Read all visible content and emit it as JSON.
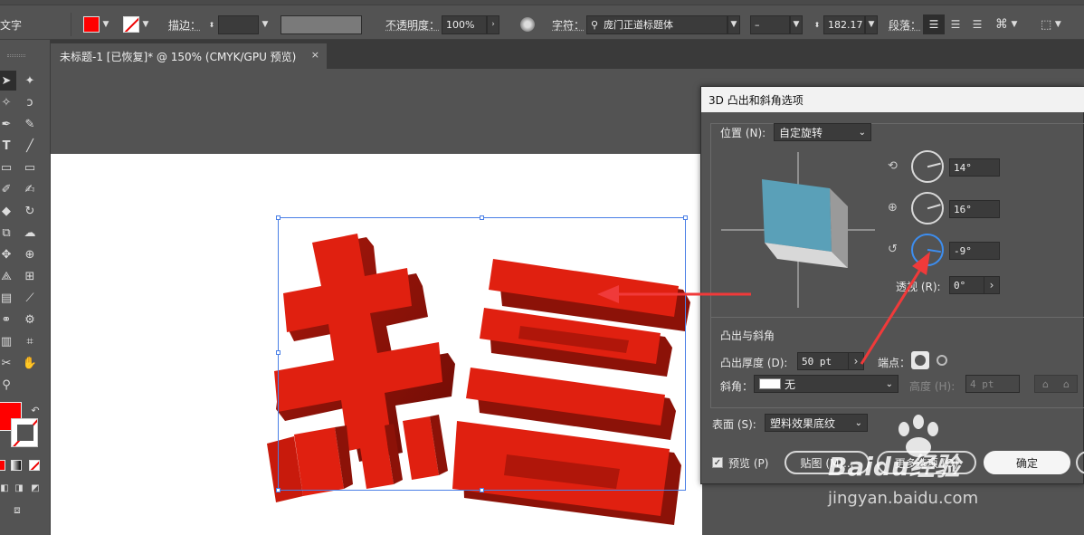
{
  "control_bar": {
    "left_label": "文字",
    "stroke_label": "描边：",
    "opacity_label": "不透明度：",
    "opacity_value": "100%",
    "char_label": "字符：",
    "font_name": "庞门正道标题体",
    "font_style": "–",
    "font_size": "182.17",
    "para_label": "段落：",
    "fill_color": "#ff0000"
  },
  "document_tab": {
    "title": "未标题-1 [已恢复]* @ 150% (CMYK/GPU 预览)",
    "close_label": "×"
  },
  "toolbar": {
    "fill_color": "#ff0000",
    "tools": [
      "selection-tool",
      "direct-selection-tool",
      "magic-wand-tool",
      "lasso-tool",
      "pen-tool",
      "curvature-tool",
      "type-tool",
      "line-tool",
      "rectangle-tool",
      "paintbrush-tool",
      "shaper-tool",
      "eraser-tool",
      "rotate-tool",
      "scale-tool",
      "warp-tool",
      "free-transform-tool",
      "shape-builder-tool",
      "perspective-grid-tool",
      "mesh-tool",
      "gradient-tool",
      "eyedropper-tool",
      "blend-tool",
      "symbol-sprayer-tool",
      "column-graph-tool",
      "artboard-tool",
      "slice-tool",
      "hand-tool",
      "zoom-tool"
    ]
  },
  "artwork": {
    "text_top": "恭喜",
    "color": "#e02010"
  },
  "dialog": {
    "title": "3D 凸出和斜角选项",
    "position_label": "位置 (N):",
    "position_value": "自定旋转",
    "rotation_x": "14°",
    "rotation_y": "16°",
    "rotation_z": "-9°",
    "perspective_label": "透视 (R):",
    "perspective_value": "0°",
    "extrude_section": "凸出与斜角",
    "extrude_depth_label": "凸出厚度 (D):",
    "extrude_depth_value": "50 pt",
    "cap_label": "端点：",
    "bevel_label": "斜角：",
    "bevel_value": "无",
    "height_label": "高度 (H):",
    "height_value": "4 pt",
    "surface_label": "表面 (S):",
    "surface_value": "塑料效果底纹",
    "preview_label": "预览 (P)",
    "map_button": "贴图 (M)...",
    "more_options_button": "更多选项 (O)",
    "ok_button": "确定",
    "cube_color": "#5aa0b8"
  },
  "watermark": {
    "brand": "Baidu经验",
    "url": "jingyan.baidu.com"
  }
}
